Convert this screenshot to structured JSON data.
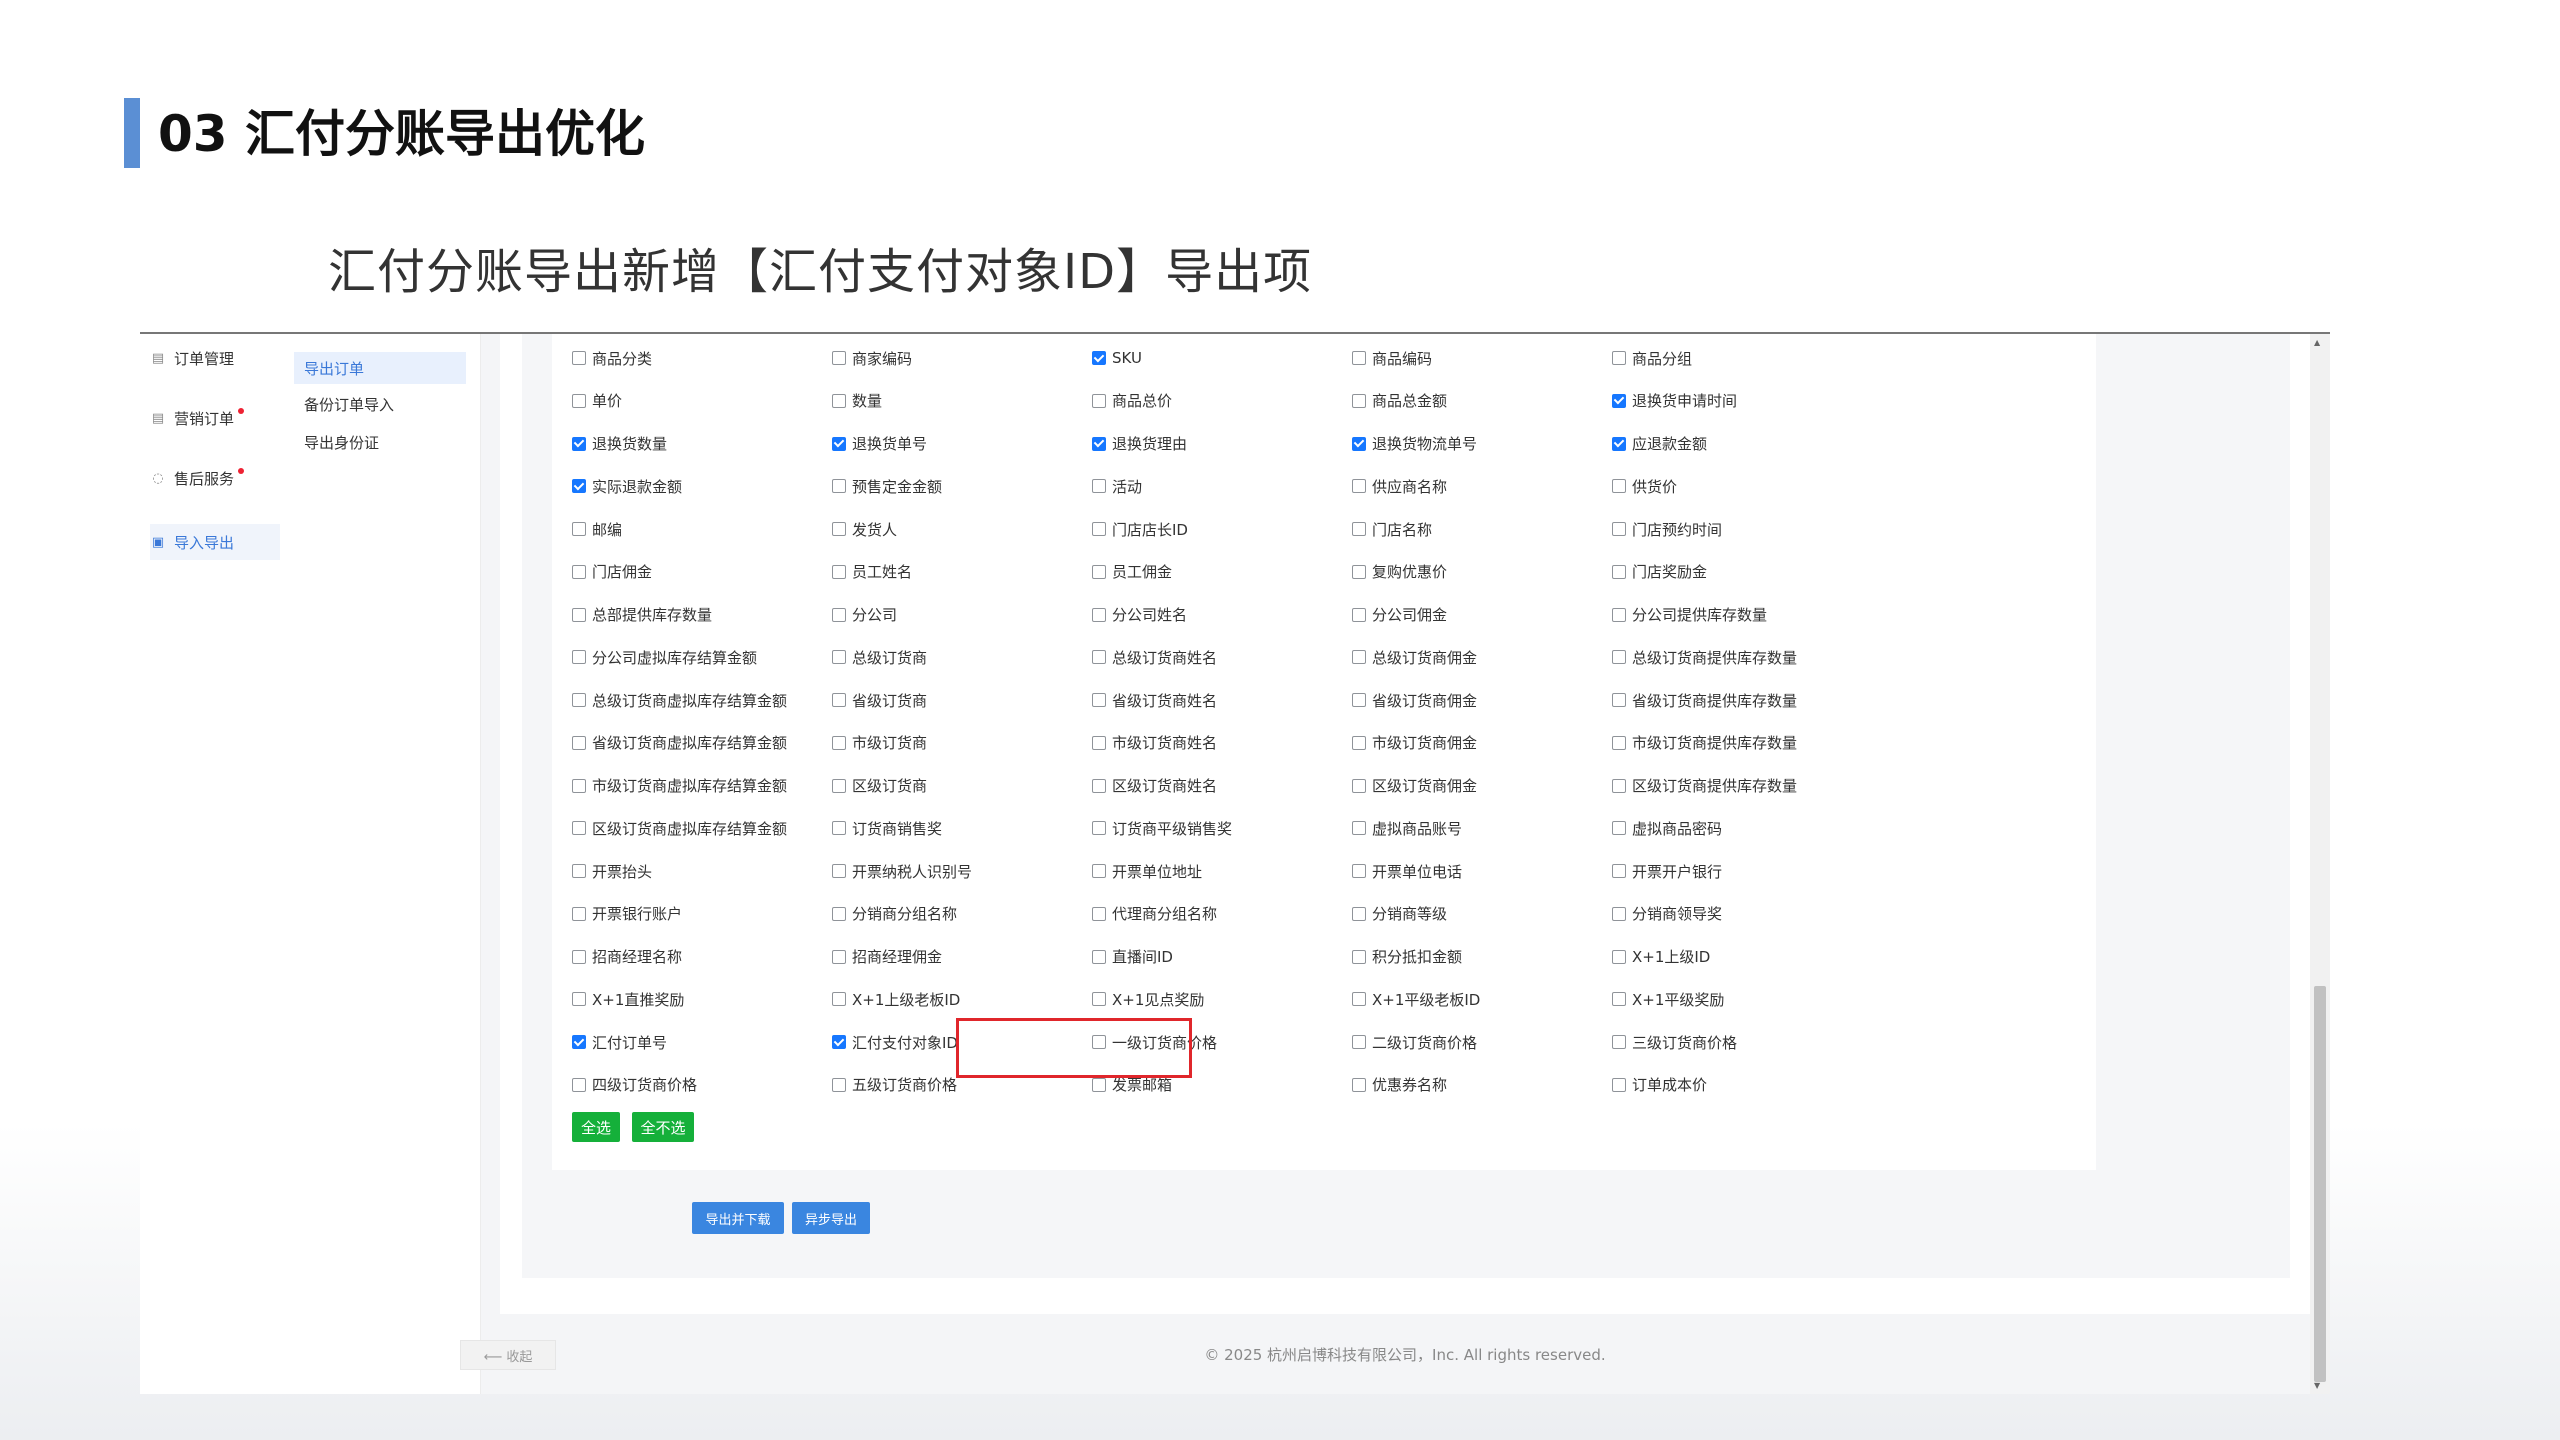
{
  "slide": {
    "title": "03 汇付分账导出优化",
    "subtitle": "汇付分账导出新增【汇付支付对象ID】导出项"
  },
  "menu": [
    {
      "label": "订单管理",
      "icon": "doc-icon",
      "glyph": "▤",
      "dot": false,
      "active": false
    },
    {
      "label": "营销订单",
      "icon": "doc-icon",
      "glyph": "▤",
      "dot": true,
      "active": false
    },
    {
      "label": "售后服务",
      "icon": "refresh-icon",
      "glyph": "◌",
      "dot": true,
      "active": false
    },
    {
      "label": "导入导出",
      "icon": "import-export-icon",
      "glyph": "▣",
      "dot": false,
      "active": true
    }
  ],
  "submenu": [
    {
      "label": "导出订单",
      "active": true
    },
    {
      "label": "备份订单导入",
      "active": false
    },
    {
      "label": "导出身份证",
      "active": false
    }
  ],
  "collapse_label": "⟵  收起",
  "fields": [
    [
      {
        "label": "商品分类",
        "checked": false
      },
      {
        "label": "商家编码",
        "checked": false
      },
      {
        "label": "SKU",
        "checked": true
      },
      {
        "label": "商品编码",
        "checked": false
      },
      {
        "label": "商品分组",
        "checked": false
      }
    ],
    [
      {
        "label": "单价",
        "checked": false
      },
      {
        "label": "数量",
        "checked": false
      },
      {
        "label": "商品总价",
        "checked": false
      },
      {
        "label": "商品总金额",
        "checked": false
      },
      {
        "label": "退换货申请时间",
        "checked": true
      }
    ],
    [
      {
        "label": "退换货数量",
        "checked": true
      },
      {
        "label": "退换货单号",
        "checked": true
      },
      {
        "label": "退换货理由",
        "checked": true
      },
      {
        "label": "退换货物流单号",
        "checked": true
      },
      {
        "label": "应退款金额",
        "checked": true
      }
    ],
    [
      {
        "label": "实际退款金额",
        "checked": true
      },
      {
        "label": "预售定金金额",
        "checked": false
      },
      {
        "label": "活动",
        "checked": false
      },
      {
        "label": "供应商名称",
        "checked": false
      },
      {
        "label": "供货价",
        "checked": false
      }
    ],
    [
      {
        "label": "邮编",
        "checked": false
      },
      {
        "label": "发货人",
        "checked": false
      },
      {
        "label": "门店店长ID",
        "checked": false
      },
      {
        "label": "门店名称",
        "checked": false
      },
      {
        "label": "门店预约时间",
        "checked": false
      }
    ],
    [
      {
        "label": "门店佣金",
        "checked": false
      },
      {
        "label": "员工姓名",
        "checked": false
      },
      {
        "label": "员工佣金",
        "checked": false
      },
      {
        "label": "复购优惠价",
        "checked": false
      },
      {
        "label": "门店奖励金",
        "checked": false
      }
    ],
    [
      {
        "label": "总部提供库存数量",
        "checked": false
      },
      {
        "label": "分公司",
        "checked": false
      },
      {
        "label": "分公司姓名",
        "checked": false
      },
      {
        "label": "分公司佣金",
        "checked": false
      },
      {
        "label": "分公司提供库存数量",
        "checked": false
      }
    ],
    [
      {
        "label": "分公司虚拟库存结算金额",
        "checked": false
      },
      {
        "label": "总级订货商",
        "checked": false
      },
      {
        "label": "总级订货商姓名",
        "checked": false
      },
      {
        "label": "总级订货商佣金",
        "checked": false
      },
      {
        "label": "总级订货商提供库存数量",
        "checked": false
      }
    ],
    [
      {
        "label": "总级订货商虚拟库存结算金额",
        "checked": false
      },
      {
        "label": "省级订货商",
        "checked": false
      },
      {
        "label": "省级订货商姓名",
        "checked": false
      },
      {
        "label": "省级订货商佣金",
        "checked": false
      },
      {
        "label": "省级订货商提供库存数量",
        "checked": false
      }
    ],
    [
      {
        "label": "省级订货商虚拟库存结算金额",
        "checked": false
      },
      {
        "label": "市级订货商",
        "checked": false
      },
      {
        "label": "市级订货商姓名",
        "checked": false
      },
      {
        "label": "市级订货商佣金",
        "checked": false
      },
      {
        "label": "市级订货商提供库存数量",
        "checked": false
      }
    ],
    [
      {
        "label": "市级订货商虚拟库存结算金额",
        "checked": false
      },
      {
        "label": "区级订货商",
        "checked": false
      },
      {
        "label": "区级订货商姓名",
        "checked": false
      },
      {
        "label": "区级订货商佣金",
        "checked": false
      },
      {
        "label": "区级订货商提供库存数量",
        "checked": false
      }
    ],
    [
      {
        "label": "区级订货商虚拟库存结算金额",
        "checked": false
      },
      {
        "label": "订货商销售奖",
        "checked": false
      },
      {
        "label": "订货商平级销售奖",
        "checked": false
      },
      {
        "label": "虚拟商品账号",
        "checked": false
      },
      {
        "label": "虚拟商品密码",
        "checked": false
      }
    ],
    [
      {
        "label": "开票抬头",
        "checked": false
      },
      {
        "label": "开票纳税人识别号",
        "checked": false
      },
      {
        "label": "开票单位地址",
        "checked": false
      },
      {
        "label": "开票单位电话",
        "checked": false
      },
      {
        "label": "开票开户银行",
        "checked": false
      }
    ],
    [
      {
        "label": "开票银行账户",
        "checked": false
      },
      {
        "label": "分销商分组名称",
        "checked": false
      },
      {
        "label": "代理商分组名称",
        "checked": false
      },
      {
        "label": "分销商等级",
        "checked": false
      },
      {
        "label": "分销商领导奖",
        "checked": false
      }
    ],
    [
      {
        "label": "招商经理名称",
        "checked": false
      },
      {
        "label": "招商经理佣金",
        "checked": false
      },
      {
        "label": "直播间ID",
        "checked": false
      },
      {
        "label": "积分抵扣金额",
        "checked": false
      },
      {
        "label": "X+1上级ID",
        "checked": false
      }
    ],
    [
      {
        "label": "X+1直推奖励",
        "checked": false
      },
      {
        "label": "X+1上级老板ID",
        "checked": false
      },
      {
        "label": "X+1见点奖励",
        "checked": false
      },
      {
        "label": "X+1平级老板ID",
        "checked": false
      },
      {
        "label": "X+1平级奖励",
        "checked": false
      }
    ],
    [
      {
        "label": "汇付订单号",
        "checked": true
      },
      {
        "label": "汇付支付对象ID",
        "checked": true
      },
      {
        "label": "一级订货商价格",
        "checked": false
      },
      {
        "label": "二级订货商价格",
        "checked": false
      },
      {
        "label": "三级订货商价格",
        "checked": false
      }
    ],
    [
      {
        "label": "四级订货商价格",
        "checked": false
      },
      {
        "label": "五级订货商价格",
        "checked": false
      },
      {
        "label": "发票邮箱",
        "checked": false
      },
      {
        "label": "优惠券名称",
        "checked": false
      },
      {
        "label": "订单成本价",
        "checked": false
      }
    ]
  ],
  "buttons": {
    "select_all": "全选",
    "select_none": "全不选",
    "export_download": "导出并下载",
    "async_export": "异步导出"
  },
  "footer": "© 2025 杭州启博科技有限公司，Inc. All rights reserved.",
  "colors": {
    "accent": "#3a78d8",
    "checkbox_on": "#1677ff",
    "highlight": "#e0262b",
    "button_green": "#15b03a",
    "button_blue": "#3a86e0"
  }
}
